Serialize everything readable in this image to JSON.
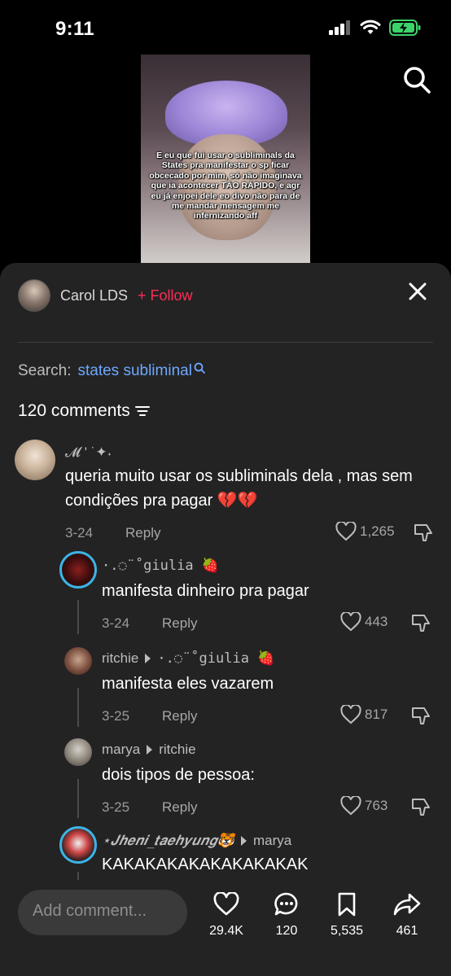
{
  "status_bar": {
    "time": "9:11"
  },
  "video": {
    "caption": "E eu que fui usar o subliminals da States pra manifestar o sp ficar obcecado por mim, só não imaginava que ia acontecer TÃO RÁPIDO, e agr eu já enjoei dele eo divo não para de me mandar mensagem me infernizando aff"
  },
  "header": {
    "author_name": "Carol LDS",
    "follow_label": "+ Follow"
  },
  "search": {
    "label": "Search:",
    "term": "states subliminal"
  },
  "comments_count": "120 comments",
  "comments": [
    {
      "user": "𝓜 ' ˙✦˖",
      "text": "queria muito usar os subliminals dela , mas sem condições pra pagar 💔💔",
      "date": "3-24",
      "reply_label": "Reply",
      "likes": "1,265"
    },
    {
      "user": "·.◌̈ ˚giulia 🍓",
      "text": "manifesta dinheiro pra pagar",
      "date": "3-24",
      "reply_label": "Reply",
      "likes": "443"
    },
    {
      "user": "ritchie",
      "reply_to": "·.◌̈ ˚giulia 🍓",
      "text": "manifesta eles vazarem",
      "date": "3-25",
      "reply_label": "Reply",
      "likes": "817"
    },
    {
      "user": "marya",
      "reply_to": "ritchie",
      "text": "dois tipos de pessoa:",
      "date": "3-25",
      "reply_label": "Reply",
      "likes": "763"
    },
    {
      "user": "⋆𝑱𝒉𝒆𝒏𝒊_𝒕𝒂𝒆𝒉𝒚𝒖𝒏𝒈🐯",
      "reply_to": "marya",
      "text": "KAKAKAKAKAKAKAKAKAK"
    }
  ],
  "bottom_bar": {
    "input_placeholder": "Add comment...",
    "likes": "29.4K",
    "comments": "120",
    "saves": "5,535",
    "shares": "461"
  },
  "colors": {
    "accent": "#fe2c55",
    "search_link": "#6ea8ff",
    "sheet_bg": "#232323"
  },
  "icons": [
    "search-icon",
    "close-icon",
    "sort-icon",
    "heart-icon",
    "dislike-icon",
    "comment-icon",
    "bookmark-icon",
    "share-icon",
    "signal-icon",
    "wifi-icon",
    "battery-icon"
  ]
}
